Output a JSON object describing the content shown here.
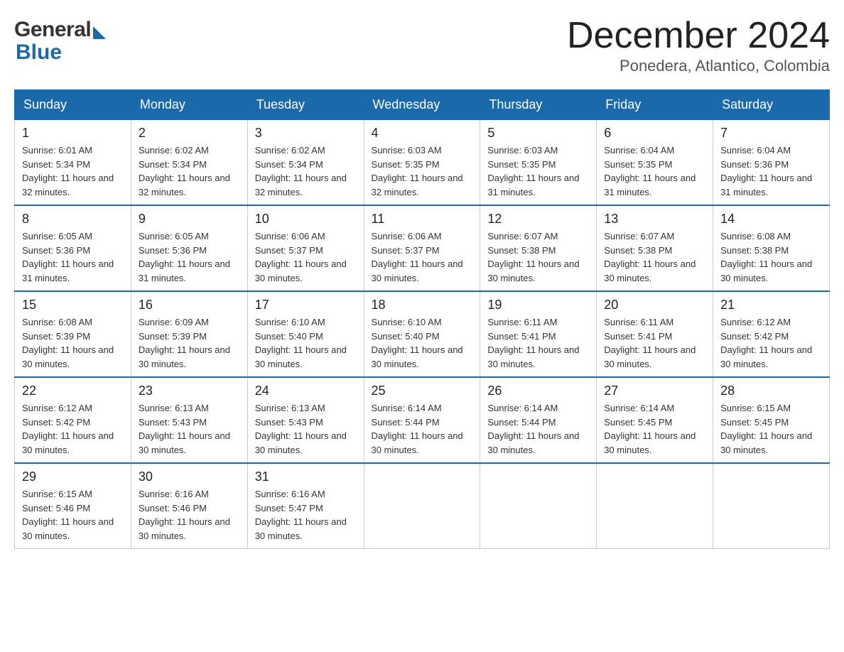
{
  "header": {
    "logo_general": "General",
    "logo_blue": "Blue",
    "month_title": "December 2024",
    "location": "Ponedera, Atlantico, Colombia"
  },
  "days_of_week": [
    "Sunday",
    "Monday",
    "Tuesday",
    "Wednesday",
    "Thursday",
    "Friday",
    "Saturday"
  ],
  "weeks": [
    [
      {
        "day": "1",
        "sunrise": "6:01 AM",
        "sunset": "5:34 PM",
        "daylight": "11 hours and 32 minutes."
      },
      {
        "day": "2",
        "sunrise": "6:02 AM",
        "sunset": "5:34 PM",
        "daylight": "11 hours and 32 minutes."
      },
      {
        "day": "3",
        "sunrise": "6:02 AM",
        "sunset": "5:34 PM",
        "daylight": "11 hours and 32 minutes."
      },
      {
        "day": "4",
        "sunrise": "6:03 AM",
        "sunset": "5:35 PM",
        "daylight": "11 hours and 32 minutes."
      },
      {
        "day": "5",
        "sunrise": "6:03 AM",
        "sunset": "5:35 PM",
        "daylight": "11 hours and 31 minutes."
      },
      {
        "day": "6",
        "sunrise": "6:04 AM",
        "sunset": "5:35 PM",
        "daylight": "11 hours and 31 minutes."
      },
      {
        "day": "7",
        "sunrise": "6:04 AM",
        "sunset": "5:36 PM",
        "daylight": "11 hours and 31 minutes."
      }
    ],
    [
      {
        "day": "8",
        "sunrise": "6:05 AM",
        "sunset": "5:36 PM",
        "daylight": "11 hours and 31 minutes."
      },
      {
        "day": "9",
        "sunrise": "6:05 AM",
        "sunset": "5:36 PM",
        "daylight": "11 hours and 31 minutes."
      },
      {
        "day": "10",
        "sunrise": "6:06 AM",
        "sunset": "5:37 PM",
        "daylight": "11 hours and 30 minutes."
      },
      {
        "day": "11",
        "sunrise": "6:06 AM",
        "sunset": "5:37 PM",
        "daylight": "11 hours and 30 minutes."
      },
      {
        "day": "12",
        "sunrise": "6:07 AM",
        "sunset": "5:38 PM",
        "daylight": "11 hours and 30 minutes."
      },
      {
        "day": "13",
        "sunrise": "6:07 AM",
        "sunset": "5:38 PM",
        "daylight": "11 hours and 30 minutes."
      },
      {
        "day": "14",
        "sunrise": "6:08 AM",
        "sunset": "5:38 PM",
        "daylight": "11 hours and 30 minutes."
      }
    ],
    [
      {
        "day": "15",
        "sunrise": "6:08 AM",
        "sunset": "5:39 PM",
        "daylight": "11 hours and 30 minutes."
      },
      {
        "day": "16",
        "sunrise": "6:09 AM",
        "sunset": "5:39 PM",
        "daylight": "11 hours and 30 minutes."
      },
      {
        "day": "17",
        "sunrise": "6:10 AM",
        "sunset": "5:40 PM",
        "daylight": "11 hours and 30 minutes."
      },
      {
        "day": "18",
        "sunrise": "6:10 AM",
        "sunset": "5:40 PM",
        "daylight": "11 hours and 30 minutes."
      },
      {
        "day": "19",
        "sunrise": "6:11 AM",
        "sunset": "5:41 PM",
        "daylight": "11 hours and 30 minutes."
      },
      {
        "day": "20",
        "sunrise": "6:11 AM",
        "sunset": "5:41 PM",
        "daylight": "11 hours and 30 minutes."
      },
      {
        "day": "21",
        "sunrise": "6:12 AM",
        "sunset": "5:42 PM",
        "daylight": "11 hours and 30 minutes."
      }
    ],
    [
      {
        "day": "22",
        "sunrise": "6:12 AM",
        "sunset": "5:42 PM",
        "daylight": "11 hours and 30 minutes."
      },
      {
        "day": "23",
        "sunrise": "6:13 AM",
        "sunset": "5:43 PM",
        "daylight": "11 hours and 30 minutes."
      },
      {
        "day": "24",
        "sunrise": "6:13 AM",
        "sunset": "5:43 PM",
        "daylight": "11 hours and 30 minutes."
      },
      {
        "day": "25",
        "sunrise": "6:14 AM",
        "sunset": "5:44 PM",
        "daylight": "11 hours and 30 minutes."
      },
      {
        "day": "26",
        "sunrise": "6:14 AM",
        "sunset": "5:44 PM",
        "daylight": "11 hours and 30 minutes."
      },
      {
        "day": "27",
        "sunrise": "6:14 AM",
        "sunset": "5:45 PM",
        "daylight": "11 hours and 30 minutes."
      },
      {
        "day": "28",
        "sunrise": "6:15 AM",
        "sunset": "5:45 PM",
        "daylight": "11 hours and 30 minutes."
      }
    ],
    [
      {
        "day": "29",
        "sunrise": "6:15 AM",
        "sunset": "5:46 PM",
        "daylight": "11 hours and 30 minutes."
      },
      {
        "day": "30",
        "sunrise": "6:16 AM",
        "sunset": "5:46 PM",
        "daylight": "11 hours and 30 minutes."
      },
      {
        "day": "31",
        "sunrise": "6:16 AM",
        "sunset": "5:47 PM",
        "daylight": "11 hours and 30 minutes."
      },
      null,
      null,
      null,
      null
    ]
  ]
}
